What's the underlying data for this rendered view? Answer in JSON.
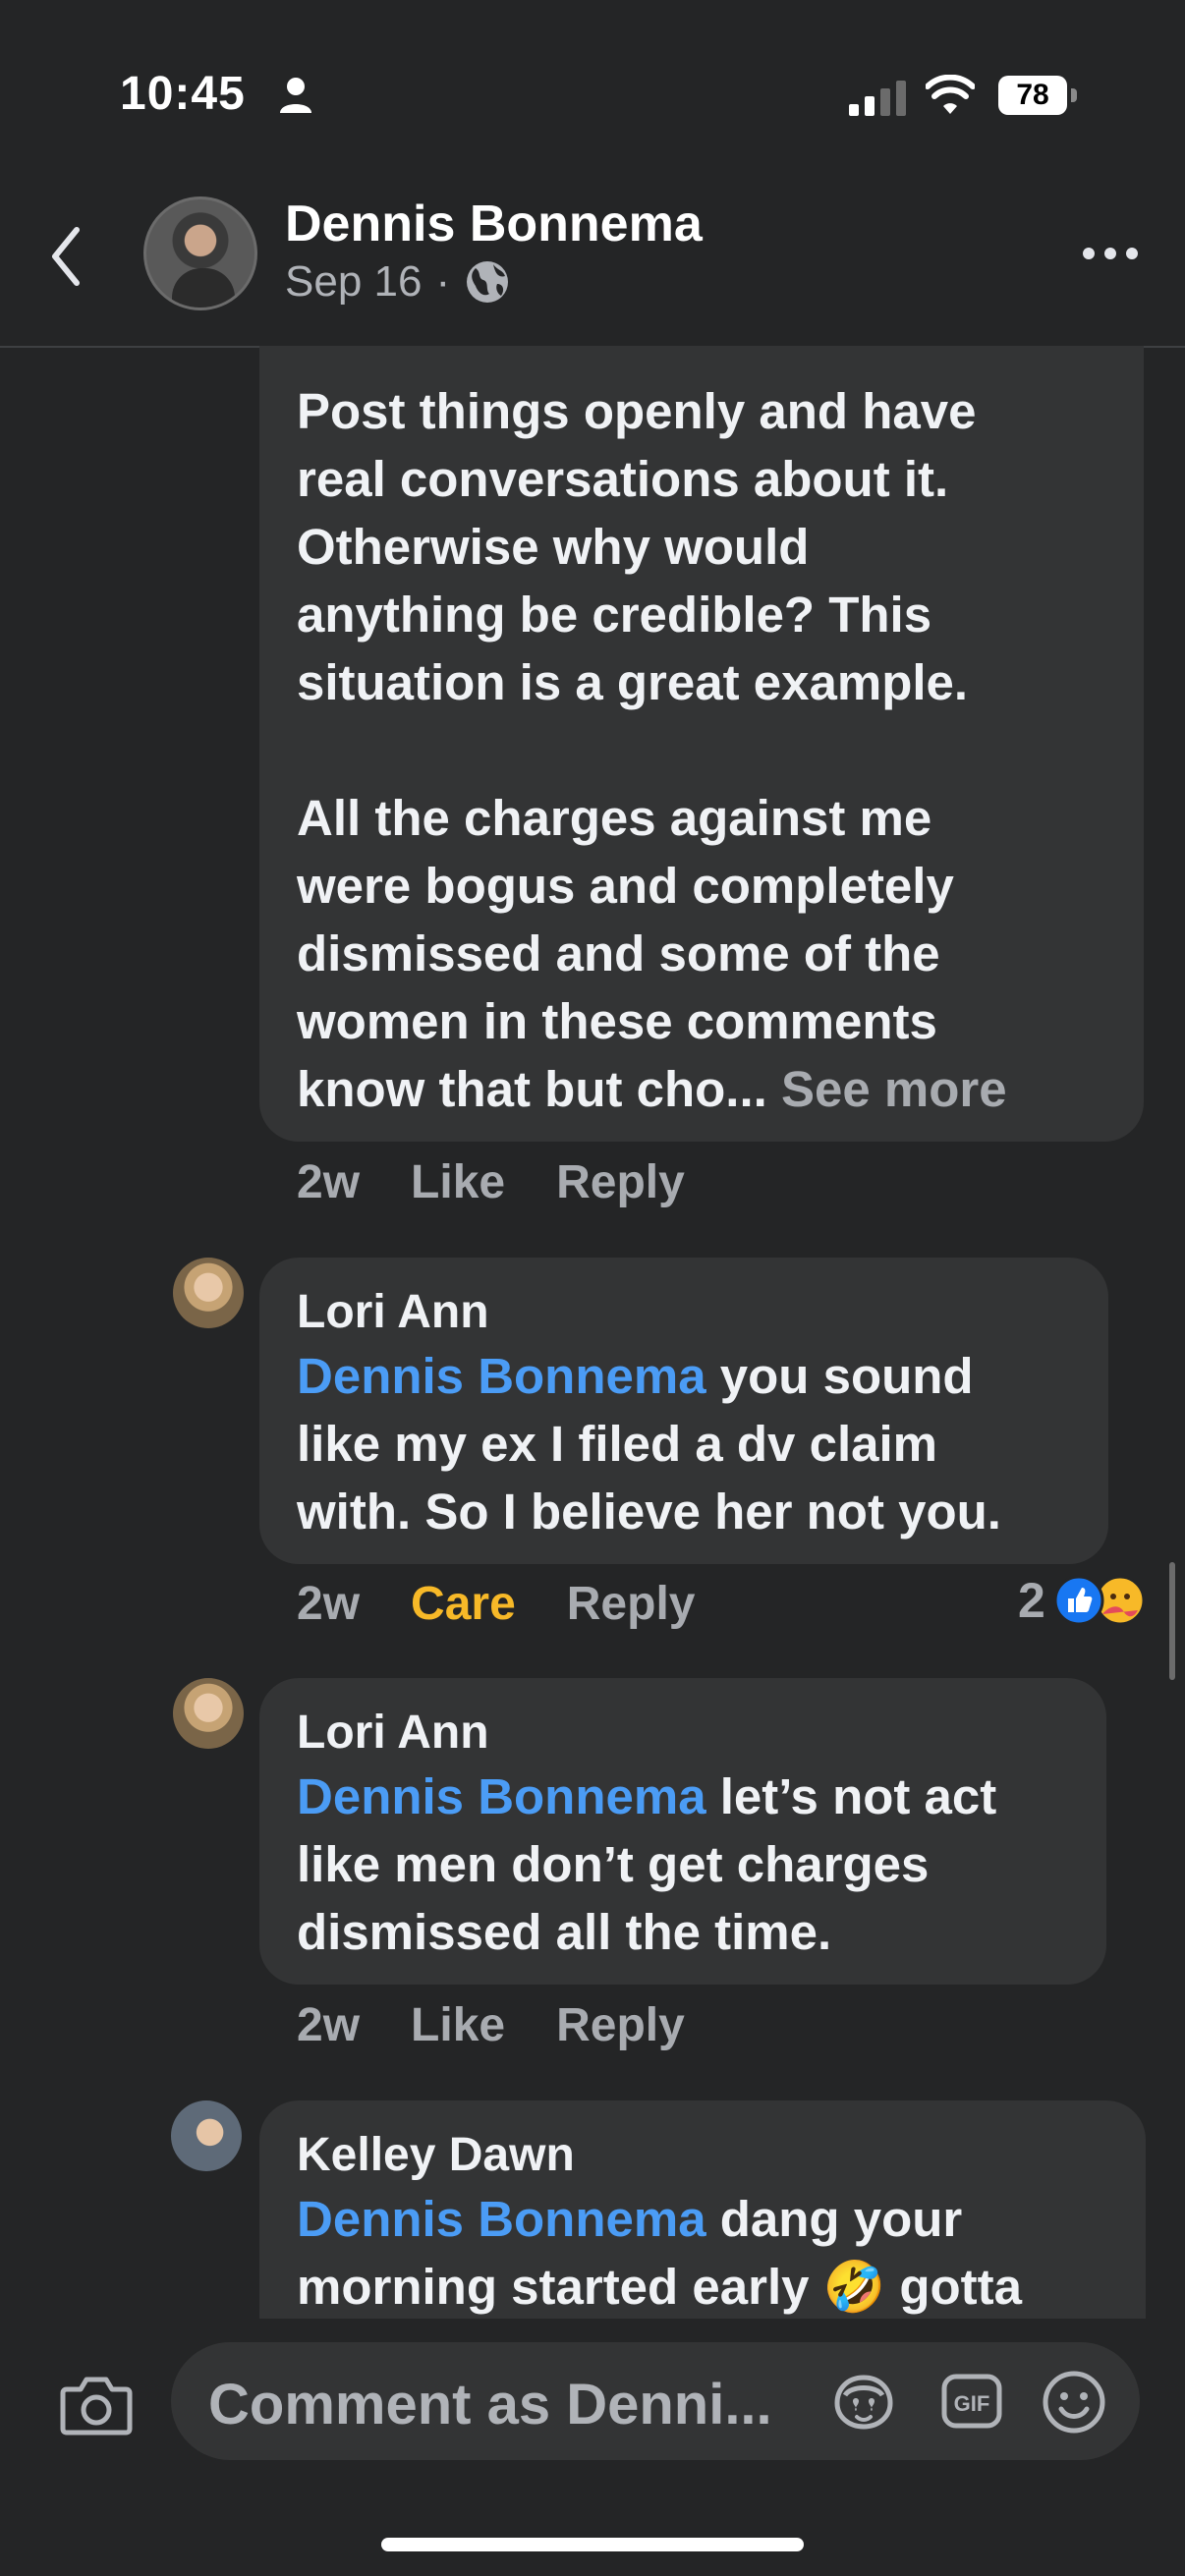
{
  "status_bar": {
    "time": "10:45",
    "battery": "78"
  },
  "header": {
    "author": "Dennis Bonnema",
    "date": "Sep 16",
    "separator": "·"
  },
  "comments": [
    {
      "text_lines": [
        "Post things openly and have",
        "real conversations about it.",
        "Otherwise why would",
        "anything be credible? This",
        "situation is a great example."
      ],
      "text_lines_2": [
        "All the charges against me",
        "were bogus and completely",
        "dismissed and some of the",
        "women in these comments"
      ],
      "last_line": "know that but cho...",
      "see_more": "See more",
      "time": "2w",
      "action1": "Like",
      "action2": "Reply"
    },
    {
      "name": "Lori Ann",
      "mention": "Dennis Bonnema",
      "line1": " you sound",
      "line2": "like my ex I filed a dv claim",
      "line3": "with. So I believe her not you.",
      "time": "2w",
      "action1": "Care",
      "action2": "Reply",
      "reaction_count": "2"
    },
    {
      "name": "Lori Ann",
      "mention": "Dennis Bonnema",
      "line1": " let’s not act",
      "line2": "like men don’t get charges",
      "line3": "dismissed all the time.",
      "time": "2w",
      "action1": "Like",
      "action2": "Reply"
    },
    {
      "name": "Kelley Dawn",
      "mention": "Dennis Bonnema",
      "line1": " dang your",
      "line2": "morning started early 🤣 gotta"
    }
  ],
  "composer": {
    "placeholder": "Comment as Denni..."
  },
  "colors": {
    "background": "#242526",
    "bubble": "#333435",
    "mention": "#4b9cf5",
    "care": "#f7b928",
    "like_blue": "#1877f2"
  }
}
